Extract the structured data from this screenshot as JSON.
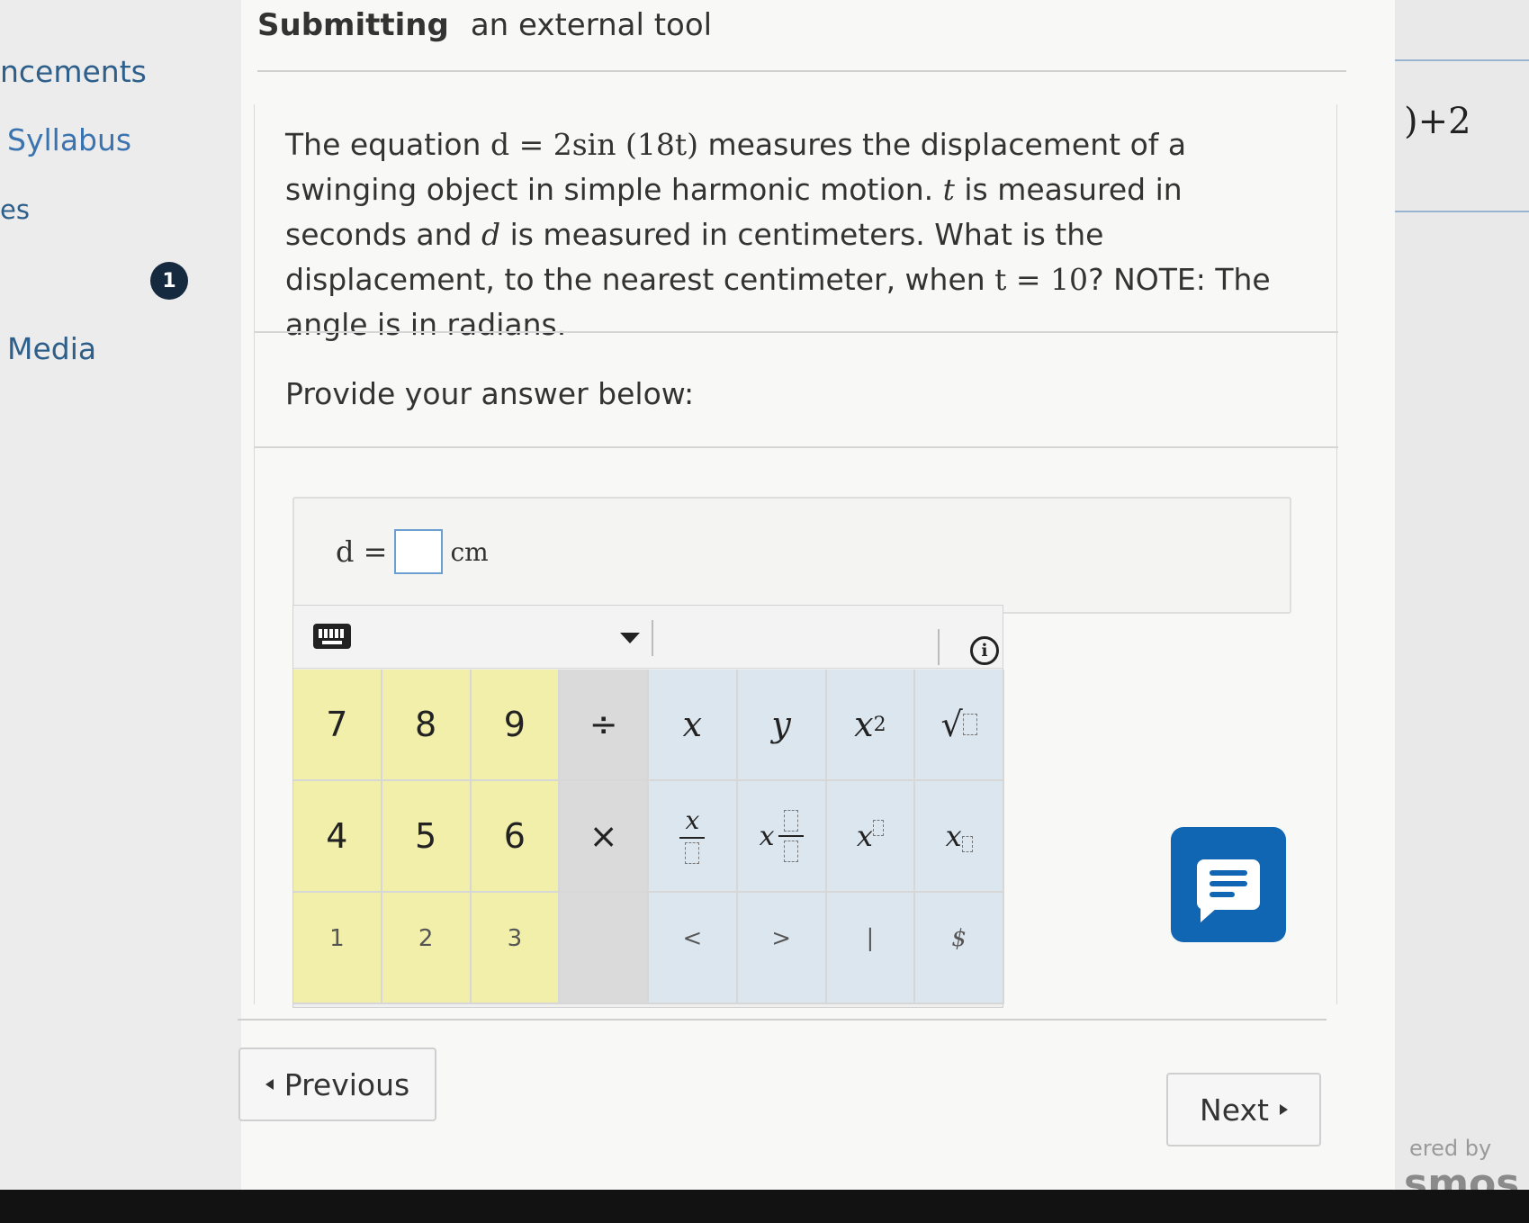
{
  "nav": {
    "announcements": "ncements",
    "syllabus": "Syllabus",
    "es": "es",
    "badge": "1",
    "media": "Media"
  },
  "header": {
    "title_bold": "Submitting",
    "title_rest": "an external tool"
  },
  "question": {
    "p1": "The equation ",
    "eq1": "d = 2sin (18t)",
    "p2": " measures the displacement of a swinging object in simple harmonic motion. ",
    "t_var": "t",
    "p3": " is measured in seconds and ",
    "d_var": "d",
    "p4": " is measured in centimeters. What is the displacement, to the nearest centimeter, when ",
    "eq2": "t = 10",
    "p5": "? NOTE: The angle is in radians."
  },
  "provide_label": "Provide your answer below:",
  "answer": {
    "lhs": "d =",
    "value": "",
    "unit": "cm"
  },
  "keypad": {
    "row1": [
      "7",
      "8",
      "9",
      "÷",
      "x",
      "y",
      "x2",
      "√"
    ],
    "row2": [
      "4",
      "5",
      "6",
      "×",
      "x/□",
      "x□/□",
      "x□",
      "x□"
    ],
    "row3": [
      "1",
      "2",
      "3",
      "",
      "<",
      ">",
      "|",
      "$"
    ],
    "sup2": "2",
    "info": "i"
  },
  "buttons": {
    "previous": "Previous",
    "next": "Next"
  },
  "desmos": {
    "expr": ")+2",
    "powered": "ered by",
    "brand": "smos"
  },
  "colors": {
    "num_keys": "#f1efaa",
    "op_keys": "#dadada",
    "fn_keys": "#dce6ee",
    "chat_button": "#1166b4",
    "link": "#3a73b0"
  }
}
